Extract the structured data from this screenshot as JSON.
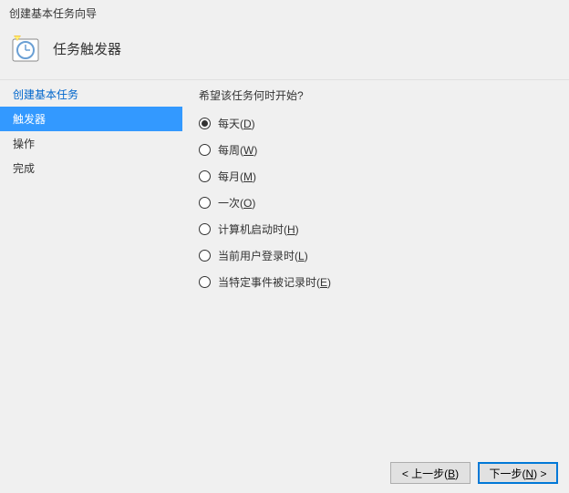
{
  "window_title": "创建基本任务向导",
  "page_heading": "任务触发器",
  "sidebar": {
    "items": [
      {
        "label": "创建基本任务",
        "selected": false
      },
      {
        "label": "触发器",
        "selected": true
      },
      {
        "label": "操作",
        "selected": false
      },
      {
        "label": "完成",
        "selected": false
      }
    ]
  },
  "content": {
    "question": "希望该任务何时开始?",
    "options": [
      {
        "text": "每天",
        "accel": "D",
        "checked": true
      },
      {
        "text": "每周",
        "accel": "W",
        "checked": false
      },
      {
        "text": "每月",
        "accel": "M",
        "checked": false
      },
      {
        "text": "一次",
        "accel": "O",
        "checked": false
      },
      {
        "text": "计算机启动时",
        "accel": "H",
        "checked": false
      },
      {
        "text": "当前用户登录时",
        "accel": "L",
        "checked": false
      },
      {
        "text": "当特定事件被记录时",
        "accel": "E",
        "checked": false
      }
    ]
  },
  "buttons": {
    "back": "< 上一步(B)",
    "next": "下一步(N) >"
  }
}
